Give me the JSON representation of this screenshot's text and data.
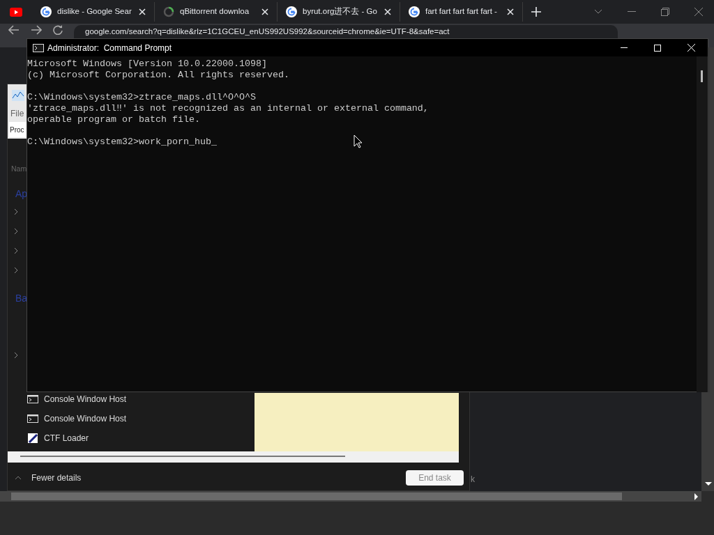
{
  "browser": {
    "tabs": [
      {
        "kind": "youtube"
      },
      {
        "kind": "google",
        "title": "dislike - Google Sear"
      },
      {
        "kind": "loading",
        "title": "qBittorrent downloa"
      },
      {
        "kind": "google",
        "title": "byrut.org进不去 - Go"
      },
      {
        "kind": "google",
        "title": "fart fart fart fart fart -"
      }
    ],
    "address": "google.com/search?q=dislike&rlz=1C1GCEU_enUS992US992&sourceid=chrome&ie=UTF-8&safe=act"
  },
  "task_manager": {
    "menu": "File",
    "tab": "Proc",
    "column": "Nam",
    "groups": [
      "Ap",
      "Ba"
    ],
    "rows": [
      {
        "kind": "console",
        "name": "Console Window Host"
      },
      {
        "kind": "console",
        "name": "Console Window Host"
      },
      {
        "kind": "ctf",
        "name": "CTF Loader"
      }
    ],
    "footer_toggle": "Fewer details",
    "end_task": "End task",
    "partial_label": "k"
  },
  "console": {
    "title": "Administrator:  Command Prompt",
    "blocks": [
      [
        "Microsoft Windows [Version 10.0.22000.1098]",
        "(c) Microsoft Corporation. All rights reserved."
      ],
      [
        "C:\\Windows\\system32>ztrace_maps.dll^O^O^S",
        "'ztrace_maps.dll‼' is not recognized as an internal or external command,",
        "operable program or batch file."
      ],
      [
        "C:\\Windows\\system32>work_porn_hub_"
      ]
    ]
  }
}
